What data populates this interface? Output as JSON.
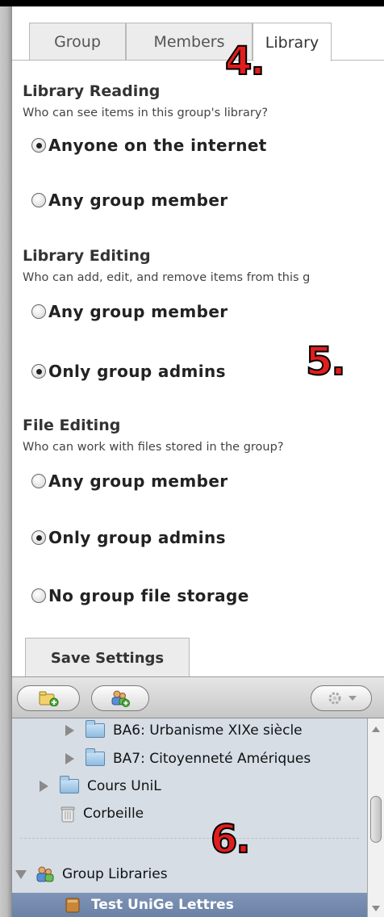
{
  "tabs": [
    {
      "label": "Group"
    },
    {
      "label": "Members"
    },
    {
      "label": "Library",
      "active": true
    }
  ],
  "step_markers": [
    "4.",
    "5.",
    "6."
  ],
  "library_reading": {
    "heading": "Library Reading",
    "question": "Who can see items in this group's library?",
    "options": [
      {
        "label": "Anyone on the internet",
        "selected": true
      },
      {
        "label": "Any group member",
        "selected": false
      }
    ]
  },
  "library_editing": {
    "heading": "Library Editing",
    "question": "Who can add, edit, and remove items from this g",
    "options": [
      {
        "label": "Any group member",
        "selected": false
      },
      {
        "label": "Only group admins",
        "selected": true
      }
    ]
  },
  "file_editing": {
    "heading": "File Editing",
    "question": "Who can work with files stored in the group?",
    "options": [
      {
        "label": "Any group member",
        "selected": false
      },
      {
        "label": "Only group admins",
        "selected": true
      },
      {
        "label": "No group file storage",
        "selected": false
      }
    ]
  },
  "save_button": "Save Settings",
  "toolbar": {
    "new_collection_icon": "new-collection-icon",
    "new_group_icon": "new-group-icon",
    "actions_icon": "gear-icon"
  },
  "tree": [
    {
      "label": "BA6: Urbanisme XIXe siècle",
      "type": "folder"
    },
    {
      "label": "BA7: Citoyenneté Amériques",
      "type": "folder"
    },
    {
      "label": "Cours UniL",
      "type": "folder"
    },
    {
      "label": "Corbeille",
      "type": "trash"
    },
    {
      "label": "Group Libraries",
      "type": "group-header"
    },
    {
      "label": "Test UniGe Lettres",
      "type": "group",
      "selected": true
    }
  ],
  "colors": {
    "selection": "#6f85a9",
    "marker_red": "#e11d1d"
  }
}
